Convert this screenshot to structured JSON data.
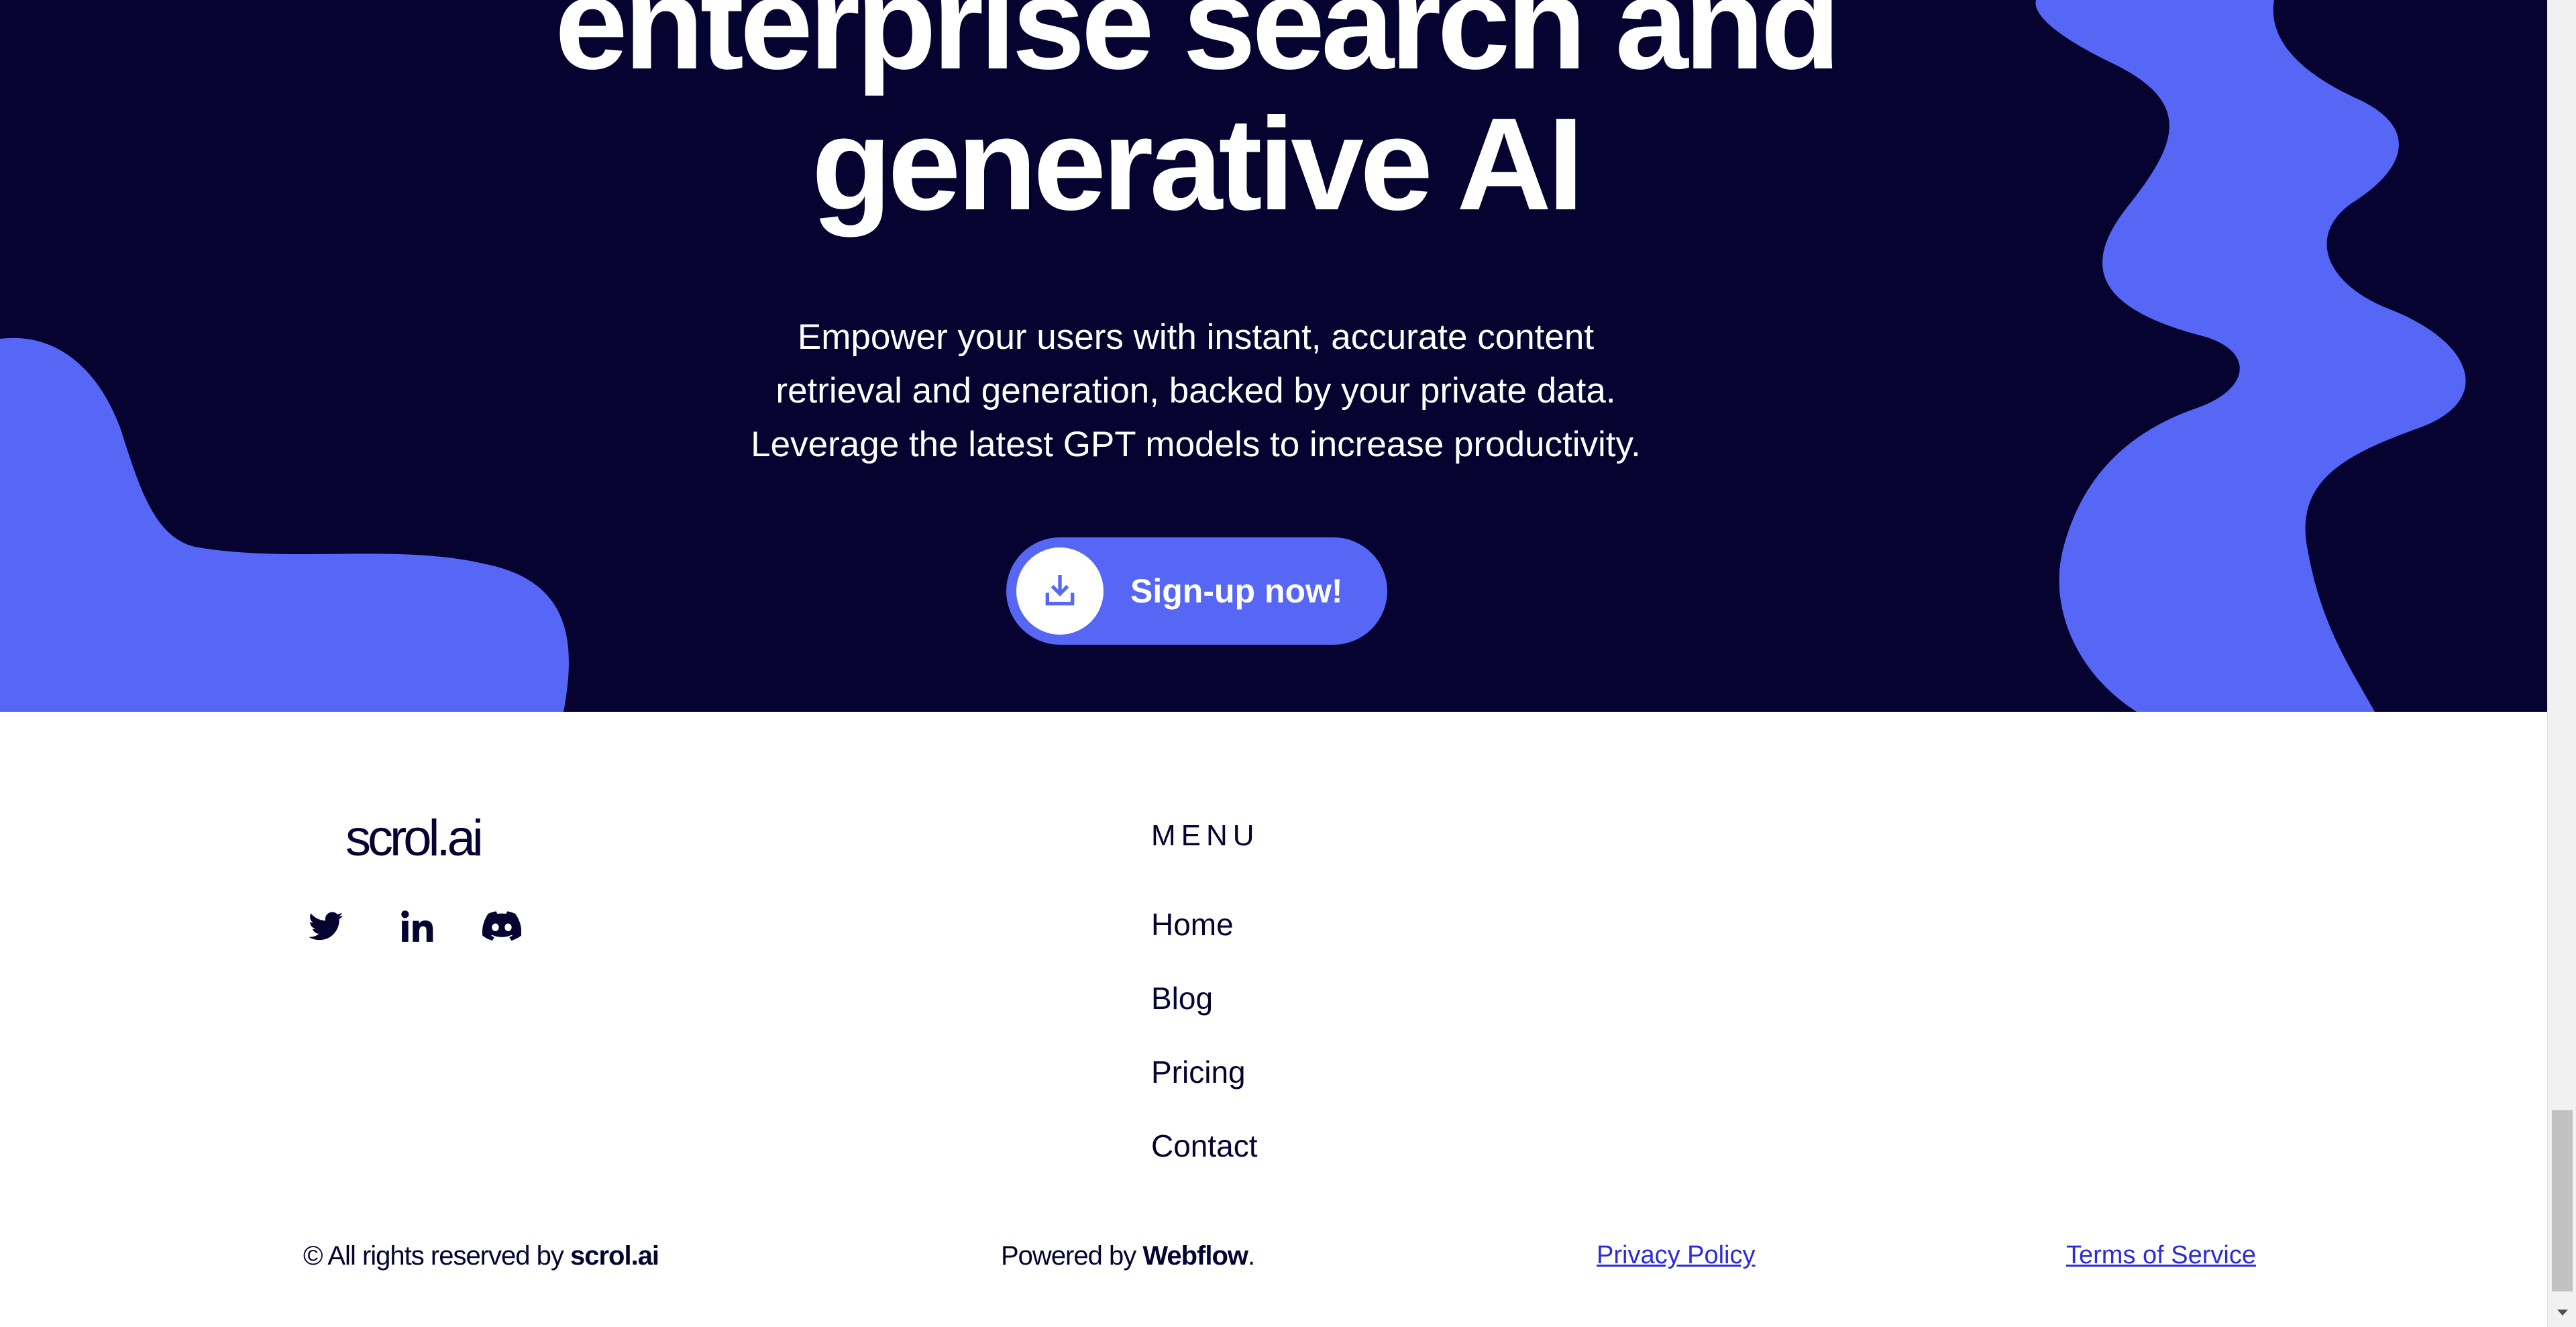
{
  "hero": {
    "heading_line1": "enterprise search and",
    "heading_line2": "generative AI",
    "sub_line1": "Empower your users with instant, accurate content",
    "sub_line2": "retrieval and generation, backed by your private data.",
    "sub_line3": "Leverage the latest GPT models to increase productivity.",
    "signup_label": "Sign-up now!",
    "signup_icon": "download-icon"
  },
  "footer": {
    "logo": "scrol.ai",
    "social": [
      {
        "name": "twitter",
        "icon": "twitter-icon"
      },
      {
        "name": "linkedin",
        "icon": "linkedin-icon"
      },
      {
        "name": "discord",
        "icon": "discord-icon"
      }
    ],
    "menu_heading": "MENU",
    "menu": [
      {
        "label": "Home"
      },
      {
        "label": "Blog"
      },
      {
        "label": "Pricing"
      },
      {
        "label": "Contact"
      }
    ],
    "copyright_prefix": "© All rights reserved by ",
    "copyright_brand": "scrol.ai",
    "powered_prefix": "Powered by ",
    "powered_brand": "Webflow",
    "powered_suffix": ".",
    "privacy_label": "Privacy Policy",
    "terms_label": "Terms of Service"
  },
  "colors": {
    "hero_background": "#060330",
    "accent_blue": "#5667f5",
    "text_dark": "#060330",
    "link_blue": "#2b2bd9"
  }
}
